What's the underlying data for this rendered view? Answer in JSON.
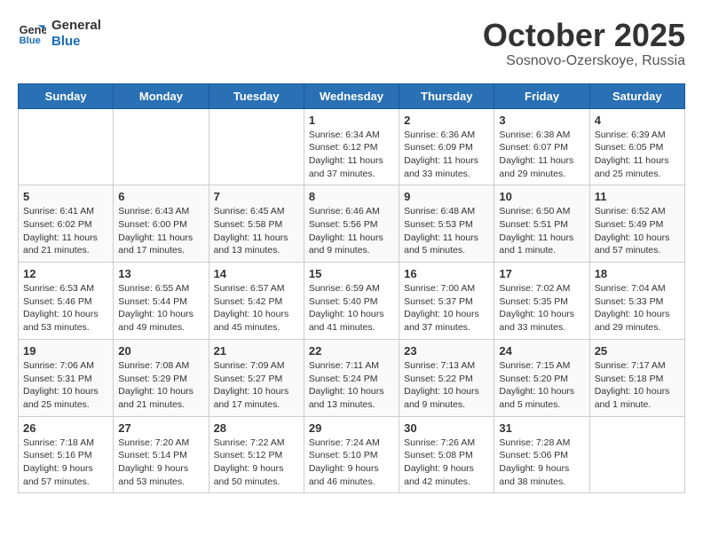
{
  "logo": {
    "line1": "General",
    "line2": "Blue"
  },
  "title": "October 2025",
  "subtitle": "Sosnovo-Ozerskoye, Russia",
  "days_header": [
    "Sunday",
    "Monday",
    "Tuesday",
    "Wednesday",
    "Thursday",
    "Friday",
    "Saturday"
  ],
  "weeks": [
    [
      {
        "day": "",
        "info": ""
      },
      {
        "day": "",
        "info": ""
      },
      {
        "day": "",
        "info": ""
      },
      {
        "day": "1",
        "info": "Sunrise: 6:34 AM\nSunset: 6:12 PM\nDaylight: 11 hours\nand 37 minutes."
      },
      {
        "day": "2",
        "info": "Sunrise: 6:36 AM\nSunset: 6:09 PM\nDaylight: 11 hours\nand 33 minutes."
      },
      {
        "day": "3",
        "info": "Sunrise: 6:38 AM\nSunset: 6:07 PM\nDaylight: 11 hours\nand 29 minutes."
      },
      {
        "day": "4",
        "info": "Sunrise: 6:39 AM\nSunset: 6:05 PM\nDaylight: 11 hours\nand 25 minutes."
      }
    ],
    [
      {
        "day": "5",
        "info": "Sunrise: 6:41 AM\nSunset: 6:02 PM\nDaylight: 11 hours\nand 21 minutes."
      },
      {
        "day": "6",
        "info": "Sunrise: 6:43 AM\nSunset: 6:00 PM\nDaylight: 11 hours\nand 17 minutes."
      },
      {
        "day": "7",
        "info": "Sunrise: 6:45 AM\nSunset: 5:58 PM\nDaylight: 11 hours\nand 13 minutes."
      },
      {
        "day": "8",
        "info": "Sunrise: 6:46 AM\nSunset: 5:56 PM\nDaylight: 11 hours\nand 9 minutes."
      },
      {
        "day": "9",
        "info": "Sunrise: 6:48 AM\nSunset: 5:53 PM\nDaylight: 11 hours\nand 5 minutes."
      },
      {
        "day": "10",
        "info": "Sunrise: 6:50 AM\nSunset: 5:51 PM\nDaylight: 11 hours\nand 1 minute."
      },
      {
        "day": "11",
        "info": "Sunrise: 6:52 AM\nSunset: 5:49 PM\nDaylight: 10 hours\nand 57 minutes."
      }
    ],
    [
      {
        "day": "12",
        "info": "Sunrise: 6:53 AM\nSunset: 5:46 PM\nDaylight: 10 hours\nand 53 minutes."
      },
      {
        "day": "13",
        "info": "Sunrise: 6:55 AM\nSunset: 5:44 PM\nDaylight: 10 hours\nand 49 minutes."
      },
      {
        "day": "14",
        "info": "Sunrise: 6:57 AM\nSunset: 5:42 PM\nDaylight: 10 hours\nand 45 minutes."
      },
      {
        "day": "15",
        "info": "Sunrise: 6:59 AM\nSunset: 5:40 PM\nDaylight: 10 hours\nand 41 minutes."
      },
      {
        "day": "16",
        "info": "Sunrise: 7:00 AM\nSunset: 5:37 PM\nDaylight: 10 hours\nand 37 minutes."
      },
      {
        "day": "17",
        "info": "Sunrise: 7:02 AM\nSunset: 5:35 PM\nDaylight: 10 hours\nand 33 minutes."
      },
      {
        "day": "18",
        "info": "Sunrise: 7:04 AM\nSunset: 5:33 PM\nDaylight: 10 hours\nand 29 minutes."
      }
    ],
    [
      {
        "day": "19",
        "info": "Sunrise: 7:06 AM\nSunset: 5:31 PM\nDaylight: 10 hours\nand 25 minutes."
      },
      {
        "day": "20",
        "info": "Sunrise: 7:08 AM\nSunset: 5:29 PM\nDaylight: 10 hours\nand 21 minutes."
      },
      {
        "day": "21",
        "info": "Sunrise: 7:09 AM\nSunset: 5:27 PM\nDaylight: 10 hours\nand 17 minutes."
      },
      {
        "day": "22",
        "info": "Sunrise: 7:11 AM\nSunset: 5:24 PM\nDaylight: 10 hours\nand 13 minutes."
      },
      {
        "day": "23",
        "info": "Sunrise: 7:13 AM\nSunset: 5:22 PM\nDaylight: 10 hours\nand 9 minutes."
      },
      {
        "day": "24",
        "info": "Sunrise: 7:15 AM\nSunset: 5:20 PM\nDaylight: 10 hours\nand 5 minutes."
      },
      {
        "day": "25",
        "info": "Sunrise: 7:17 AM\nSunset: 5:18 PM\nDaylight: 10 hours\nand 1 minute."
      }
    ],
    [
      {
        "day": "26",
        "info": "Sunrise: 7:18 AM\nSunset: 5:16 PM\nDaylight: 9 hours\nand 57 minutes."
      },
      {
        "day": "27",
        "info": "Sunrise: 7:20 AM\nSunset: 5:14 PM\nDaylight: 9 hours\nand 53 minutes."
      },
      {
        "day": "28",
        "info": "Sunrise: 7:22 AM\nSunset: 5:12 PM\nDaylight: 9 hours\nand 50 minutes."
      },
      {
        "day": "29",
        "info": "Sunrise: 7:24 AM\nSunset: 5:10 PM\nDaylight: 9 hours\nand 46 minutes."
      },
      {
        "day": "30",
        "info": "Sunrise: 7:26 AM\nSunset: 5:08 PM\nDaylight: 9 hours\nand 42 minutes."
      },
      {
        "day": "31",
        "info": "Sunrise: 7:28 AM\nSunset: 5:06 PM\nDaylight: 9 hours\nand 38 minutes."
      },
      {
        "day": "",
        "info": ""
      }
    ]
  ]
}
